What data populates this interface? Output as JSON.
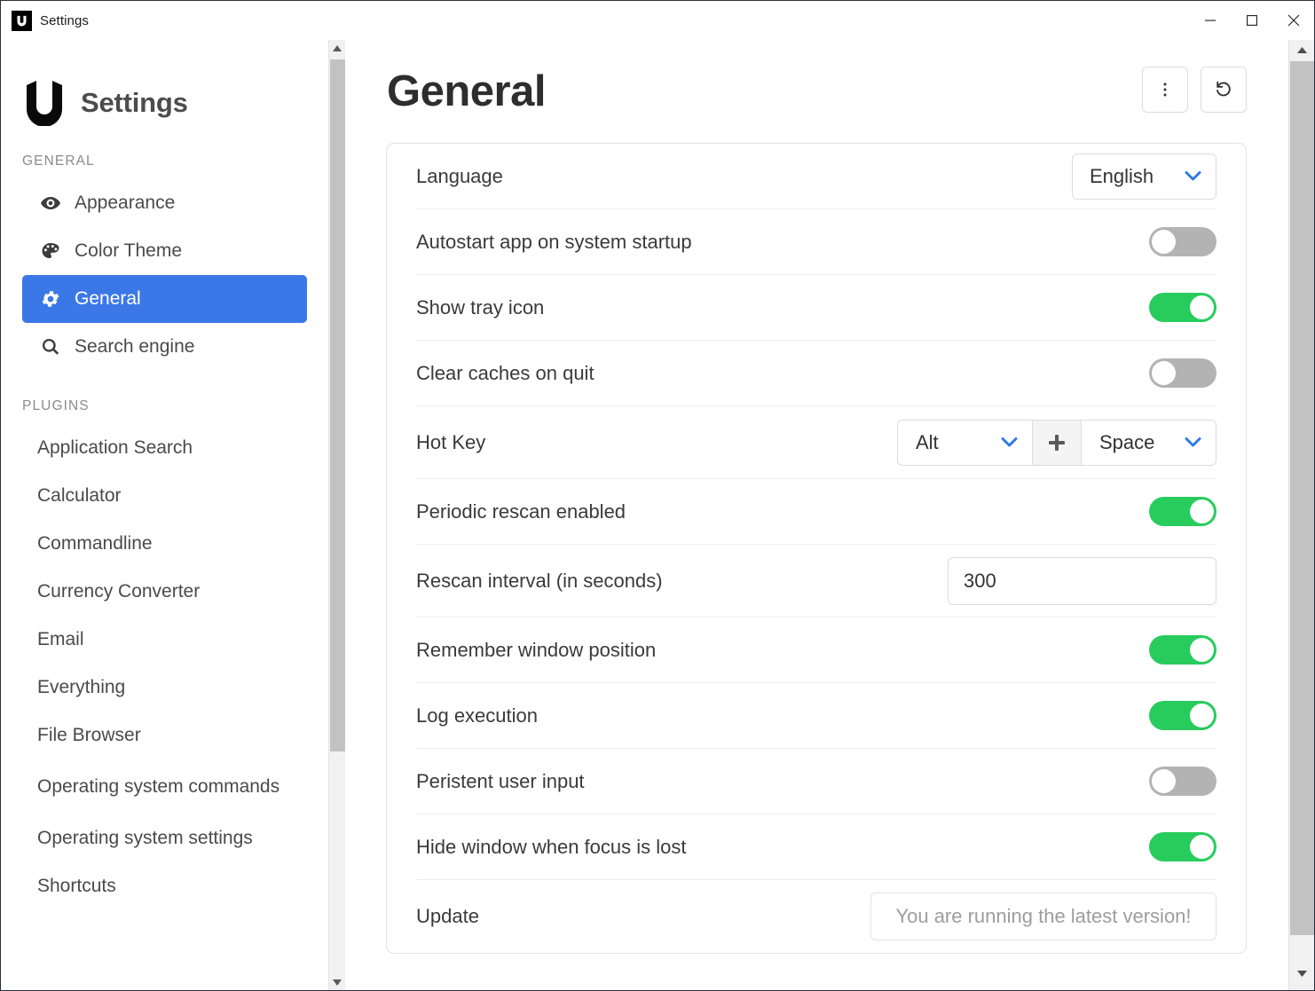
{
  "titlebar": {
    "app_icon": "ueli-logo-icon",
    "title": "Settings",
    "minimize_label": "minimize-icon",
    "maximize_label": "maximize-icon",
    "close_label": "close-icon"
  },
  "sidebar": {
    "brand_title": "Settings",
    "brand_logo": "ueli-logo-icon",
    "sections": [
      {
        "label": "GENERAL",
        "items": [
          {
            "label": "Appearance",
            "icon": "eye-icon",
            "active": false
          },
          {
            "label": "Color Theme",
            "icon": "palette-icon",
            "active": false
          },
          {
            "label": "General",
            "icon": "gear-icon",
            "active": true
          },
          {
            "label": "Search engine",
            "icon": "search-icon",
            "active": false
          }
        ]
      },
      {
        "label": "PLUGINS",
        "items": [
          {
            "label": "Application Search"
          },
          {
            "label": "Calculator"
          },
          {
            "label": "Commandline"
          },
          {
            "label": "Currency Converter"
          },
          {
            "label": "Email"
          },
          {
            "label": "Everything"
          },
          {
            "label": "File Browser"
          },
          {
            "label": "Operating system commands"
          },
          {
            "label": "Operating system settings"
          },
          {
            "label": "Shortcuts"
          }
        ]
      }
    ]
  },
  "main": {
    "page_title": "General",
    "actions": {
      "more_label": "more-vertical-icon",
      "reset_label": "reset-icon"
    },
    "rows": [
      {
        "label": "Language",
        "control": "select",
        "value": "English"
      },
      {
        "label": "Autostart app on system startup",
        "control": "toggle",
        "value": "off"
      },
      {
        "label": "Show tray icon",
        "control": "toggle",
        "value": "on"
      },
      {
        "label": "Clear caches on quit",
        "control": "toggle",
        "value": "off"
      },
      {
        "label": "Hot Key",
        "control": "hotkey",
        "modifier": "Alt",
        "separator": "+",
        "key": "Space"
      },
      {
        "label": "Periodic rescan enabled",
        "control": "toggle",
        "value": "on"
      },
      {
        "label": "Rescan interval (in seconds)",
        "control": "input",
        "value": "300"
      },
      {
        "label": "Remember window position",
        "control": "toggle",
        "value": "on"
      },
      {
        "label": "Log execution",
        "control": "toggle",
        "value": "on"
      },
      {
        "label": "Peristent user input",
        "control": "toggle",
        "value": "off"
      },
      {
        "label": "Hide window when focus is lost",
        "control": "toggle",
        "value": "on"
      },
      {
        "label": "Update",
        "control": "button",
        "value": "You are running the latest version!"
      }
    ]
  },
  "colors": {
    "accent_blue": "#3b78e7",
    "toggle_on_green": "#27cc5d",
    "toggle_off_gray": "#b3b3b3",
    "chevron_blue": "#2f7ae5"
  }
}
